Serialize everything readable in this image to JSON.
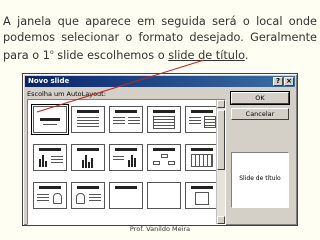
{
  "caption": {
    "part1": "A janela que aparece em seguida será o local onde podemos selecionar o formato desejado. Geralmente para o 1",
    "sup": "o",
    "part2": " slide escolhemos o ",
    "link": "slide de título",
    "end": "."
  },
  "dialog": {
    "title": "Novo slide",
    "help_btn": "?",
    "close_btn": "×",
    "layout_label": "Escolha um AutoLayout:",
    "ok": "OK",
    "cancel": "Cancelar",
    "preview_label": "Slide de título"
  },
  "footer": "Prof. Vanildo Meira",
  "colors": {
    "pointer_line": "#cc2222",
    "titlebar": "#0a246a"
  }
}
